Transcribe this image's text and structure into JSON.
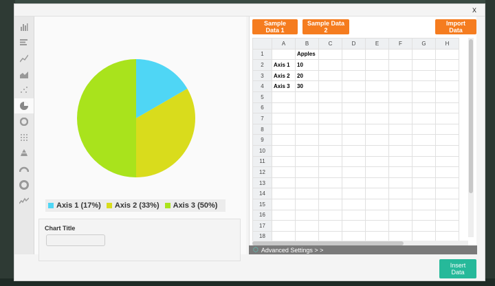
{
  "modal": {
    "close_label": "x"
  },
  "sidebar": {
    "icons": [
      "column-chart-icon",
      "bar-chart-icon",
      "line-chart-icon",
      "area-chart-icon",
      "scatter-chart-icon",
      "pie-chart-icon",
      "donut-chart-icon",
      "dot-matrix-icon",
      "pyramid-chart-icon",
      "gauge-chart-icon",
      "ring-chart-icon",
      "sparkline-icon"
    ],
    "active": "pie-chart-icon"
  },
  "toolbar": {
    "sample1_label": "Sample Data 1",
    "sample2_label": "Sample Data 2",
    "import_label": "Import Data"
  },
  "grid": {
    "columns": [
      "A",
      "B",
      "C",
      "D",
      "E",
      "F",
      "G",
      "H"
    ],
    "rows": [
      "1",
      "2",
      "3",
      "4",
      "5",
      "6",
      "7",
      "8",
      "9",
      "10",
      "11",
      "12",
      "13",
      "14",
      "15",
      "16",
      "17",
      "18"
    ],
    "cells": {
      "1": [
        "",
        "Apples"
      ],
      "2": [
        "Axis 1",
        "10"
      ],
      "3": [
        "Axis 2",
        "20"
      ],
      "4": [
        "Axis 3",
        "30"
      ]
    }
  },
  "chart_data": {
    "type": "pie",
    "categories": [
      "Axis 1",
      "Axis 2",
      "Axis 3"
    ],
    "values": [
      10,
      20,
      30
    ],
    "legend": [
      "Axis 1 (17%)",
      "Axis 2 (33%)",
      "Axis 3 (50%)"
    ],
    "colors": [
      "#4fd6f5",
      "#d9dc1c",
      "#a9e31c"
    ],
    "title": "",
    "legend_placement": "bottom"
  },
  "chart_title": {
    "label": "Chart Title",
    "value": ""
  },
  "advanced": {
    "label": "Advanced Settings > >"
  },
  "insert": {
    "label": "Insert Data"
  }
}
